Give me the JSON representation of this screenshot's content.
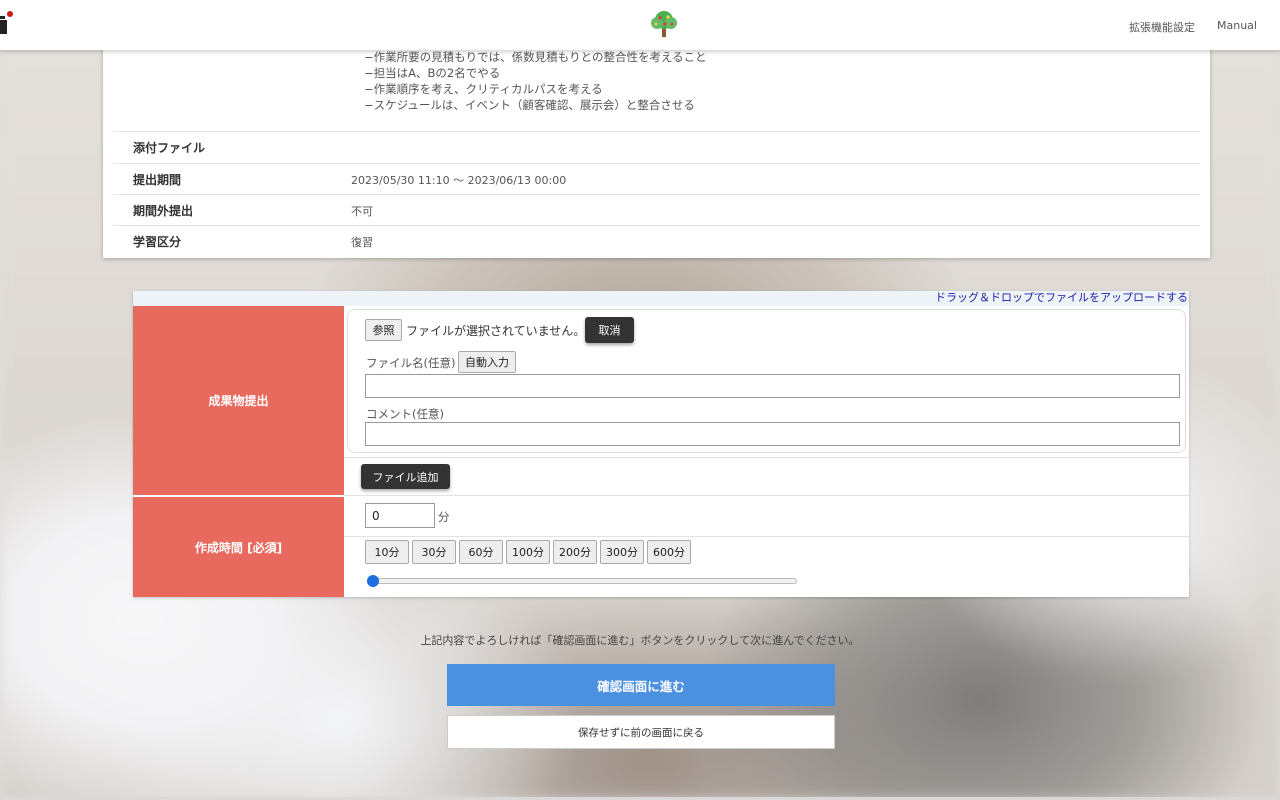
{
  "header": {
    "ext_settings": "拡張機能設定",
    "manual": "Manual"
  },
  "assignment": {
    "description_lines": [
      "−作業所要の見積もりでは、係数見積もりとの整合性を考えること",
      "−担当はA、Bの2名でやる",
      "−作業順序を考え、クリティカルパスを考える",
      "−スケジュールは、イベント（顧客確認、展示会）と整合させる"
    ],
    "rows": [
      {
        "label": "添付ファイル",
        "value": ""
      },
      {
        "label": "提出期間",
        "value": "2023/05/30 11:10 〜 2023/06/13 00:00"
      },
      {
        "label": "期間外提出",
        "value": "不可"
      },
      {
        "label": "学習区分",
        "value": "復習"
      }
    ]
  },
  "submission": {
    "drag_drop_link": "ドラッグ＆ドロップでファイルをアップロードする",
    "label": "成果物提出",
    "browse_button": "参照",
    "no_file_text": "ファイルが選択されていません。",
    "cancel_button": "取消",
    "filename_label": "ファイル名(任意)",
    "autofill_button": "自動入力",
    "filename_value": "",
    "comment_label": "コメント(任意)",
    "comment_value": "",
    "add_file_button": "ファイル追加"
  },
  "work_time": {
    "label": "作成時間 [必須]",
    "value": "0",
    "unit": "分",
    "presets": [
      "10分",
      "30分",
      "60分",
      "100分",
      "200分",
      "300分",
      "600分"
    ],
    "slider_fraction": 0
  },
  "footer": {
    "hint": "上記内容でよろしければ「確認画面に進む」ボタンをクリックして次に進んでください。",
    "confirm_button": "確認画面に進む",
    "back_button": "保存せずに前の画面に戻る"
  },
  "colors": {
    "label_red": "#e86a5e",
    "confirm_blue": "#4c90e0",
    "link_blue": "#1a1aa6",
    "slider_blue": "#1e6fe0"
  }
}
